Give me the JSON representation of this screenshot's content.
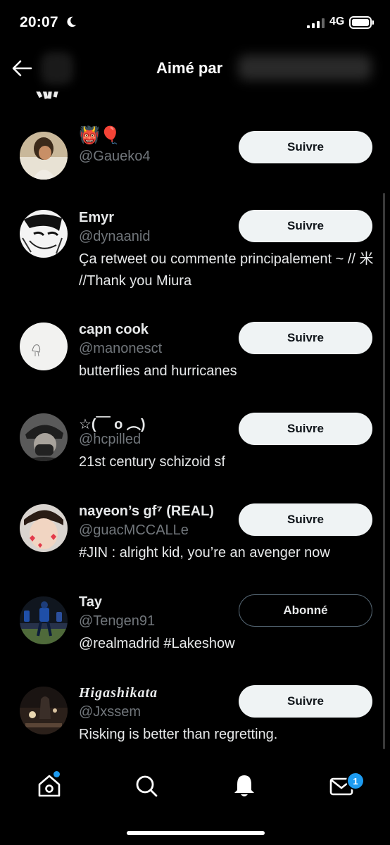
{
  "status": {
    "time": "20:07",
    "network": "4G"
  },
  "header": {
    "title": "Aimé par"
  },
  "users": [
    {
      "name": "👹🎈",
      "handle": "@Gaueko4",
      "bio": "",
      "button": "Suivre",
      "following": false
    },
    {
      "name": "Emyr",
      "handle": "@dynaanid",
      "bio": "Ça retweet ou commente principalement ~ // ⽶ //Thank you Miura",
      "button": "Suivre",
      "following": false
    },
    {
      "name": "capn cook",
      "handle": "@manonesct",
      "bio": "butterflies and hurricanes",
      "button": "Suivre",
      "following": false
    },
    {
      "name": "☆(￣ ο ︵)",
      "handle": "@hcpilled",
      "bio": "21st century schizoid sf",
      "button": "Suivre",
      "following": false
    },
    {
      "name": "nayeon’s gf⁷ (REAL)",
      "handle": "@guacMCCALLe",
      "bio": "#JIN : alright kid, you’re an avenger now",
      "button": "Suivre",
      "following": false
    },
    {
      "name": "Tay",
      "handle": "@Tengen91",
      "bio": "@realmadrid #Lakeshow",
      "button": "Abonné",
      "following": true
    },
    {
      "name": "Higashikata",
      "handle": "@Jxssem",
      "bio": "Risking is better than regretting.",
      "button": "Suivre",
      "following": false
    }
  ],
  "tabbar": {
    "messages_badge": "1"
  },
  "colors": {
    "accent": "#1d9bf0",
    "background": "#000000",
    "muted": "#71767b"
  }
}
